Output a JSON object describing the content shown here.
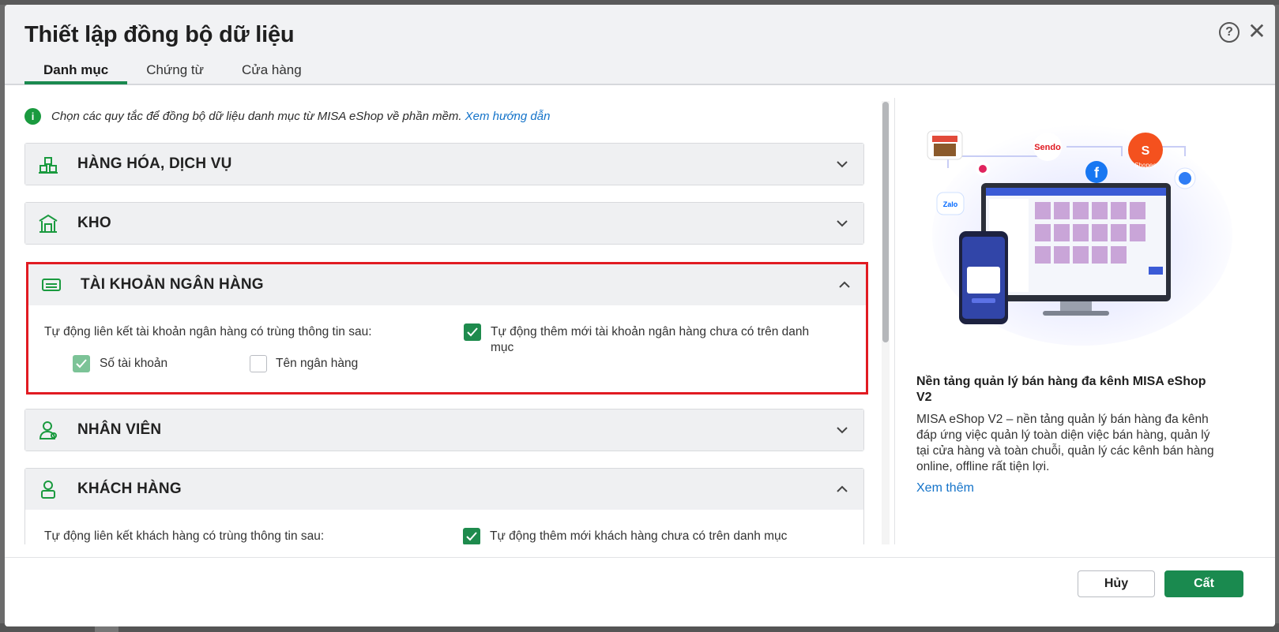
{
  "dialog": {
    "title": "Thiết lập đồng bộ dữ liệu",
    "tabs": [
      {
        "label": "Danh mục",
        "active": true
      },
      {
        "label": "Chứng từ",
        "active": false
      },
      {
        "label": "Cửa hàng",
        "active": false
      }
    ],
    "help_icon": "question-circle-icon",
    "close_icon": "close-icon"
  },
  "info": {
    "text": "Chọn các quy tắc để đồng bộ dữ liệu danh mục từ MISA eShop về phần mềm.",
    "link": "Xem hướng dẫn"
  },
  "sections": [
    {
      "title": "HÀNG HÓA, DỊCH VỤ",
      "icon": "boxes-icon",
      "expanded": false
    },
    {
      "title": "KHO",
      "icon": "warehouse-icon",
      "expanded": false
    },
    {
      "title": "TÀI KHOẢN NGÂN HÀNG",
      "icon": "bank-card-icon",
      "expanded": true,
      "highlighted": true,
      "link_label": "Tự động liên kết tài khoản ngân hàng có trùng thông tin sau:",
      "options": [
        {
          "label": "Số tài khoản",
          "checked": true
        },
        {
          "label": "Tên ngân hàng",
          "checked": false
        }
      ],
      "auto_add": {
        "label_line1": "Tự động thêm mới tài khoản ngân hàng chưa có trên danh",
        "label_line2": "mục",
        "checked": true
      }
    },
    {
      "title": "NHÂN VIÊN",
      "icon": "employee-icon",
      "expanded": false
    },
    {
      "title": "KHÁCH HÀNG",
      "icon": "customer-icon",
      "expanded": true,
      "link_label": "Tự động liên kết khách hàng có trùng thông tin sau:",
      "auto_add": {
        "label_line1": "Tự động thêm mới khách hàng chưa có trên danh mục",
        "checked": true
      }
    }
  ],
  "promo": {
    "image_labels": [
      "Sendo",
      "Zalo",
      "Shopee"
    ],
    "title": "Nền tảng quản lý bán hàng đa kênh MISA eShop V2",
    "description": "MISA eShop V2 – nền tảng quản lý bán hàng đa kênh đáp ứng việc quản lý toàn diện việc bán hàng, quản lý tại cửa hàng và toàn chuỗi, quản lý các kênh bán hàng online, offline rất tiện lợi.",
    "link": "Xem thêm"
  },
  "footer": {
    "cancel_label": "Hủy",
    "save_label": "Cất"
  },
  "colors": {
    "accent": "#1a8a4f",
    "highlight_border": "#e11b22",
    "link": "#1473c9"
  }
}
